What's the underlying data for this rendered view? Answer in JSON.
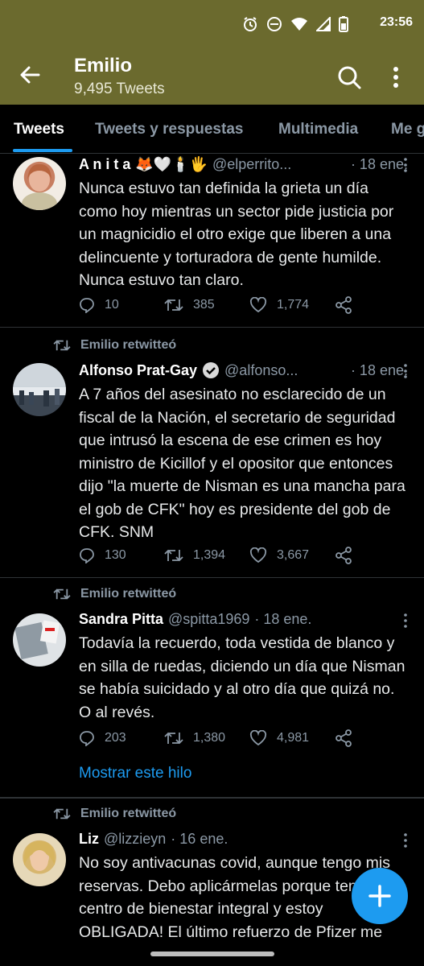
{
  "status_bar": {
    "time": "23:56"
  },
  "header": {
    "title": "Emilio",
    "subtitle": "9,495 Tweets"
  },
  "tabs": [
    {
      "label": "Tweets",
      "active": true
    },
    {
      "label": "Tweets y respuestas",
      "active": false
    },
    {
      "label": "Multimedia",
      "active": false
    },
    {
      "label": "Me gusta",
      "active": false
    }
  ],
  "tweets": [
    {
      "retweet_label": "",
      "name": "A n i t a",
      "emoji": "🦊🤍🕯️🖐",
      "handle": "@elperrito...",
      "time": "· 18 ene.",
      "text": "Nunca estuvo tan definida la grieta un día como hoy mientras un sector pide justicia por un magnicidio el otro exige que liberen a una delincuente y torturadora de gente humilde. Nunca estuvo tan claro.",
      "replies": "10",
      "retweets": "385",
      "likes": "1,774"
    },
    {
      "retweet_label": "Emilio retwitteó",
      "name": "Alfonso Prat-Gay",
      "verified": true,
      "handle": "@alfonso...",
      "time": "· 18 ene.",
      "text": "A 7 años del asesinato no esclarecido de un fiscal de la Nación, el secretario de seguridad que intrusó la escena de ese crimen es hoy ministro de Kicillof y el opositor que entonces dijo \"la muerte de Nisman es una mancha para el gob de CFK\" hoy es presidente del gob de CFK. SNM",
      "replies": "130",
      "retweets": "1,394",
      "likes": "3,667"
    },
    {
      "retweet_label": "Emilio retwitteó",
      "name": "Sandra Pitta",
      "handle": "@spitta1969",
      "time": "· 18 ene.",
      "text": "Todavía la recuerdo, toda vestida de blanco y en silla de ruedas, diciendo un día que Nisman se había suicidado y al otro día que quizá no. O al revés.",
      "replies": "203",
      "retweets": "1,380",
      "likes": "4,981",
      "show_thread": "Mostrar este hilo"
    },
    {
      "retweet_label": "Emilio retwitteó",
      "name": "Liz",
      "handle": "@lizzieyn",
      "time": "· 16 ene.",
      "text": "No soy antivacunas covid, aunque tengo mis reservas. Debo aplicármelas porque tengo un centro de bienestar integral y estoy OBLIGADA! El último refuerzo de Pfizer me"
    }
  ],
  "colors": {
    "header_bg": "#6b6a2e",
    "accent": "#1d9bf0",
    "muted": "#8b98a5"
  },
  "icons": [
    "alarm-icon",
    "dnd-icon",
    "wifi-icon",
    "signal-icon",
    "battery-icon",
    "back-arrow-icon",
    "search-icon",
    "more-vertical-icon",
    "reply-icon",
    "retweet-icon",
    "like-icon",
    "share-icon",
    "verified-icon",
    "compose-plus-icon"
  ]
}
